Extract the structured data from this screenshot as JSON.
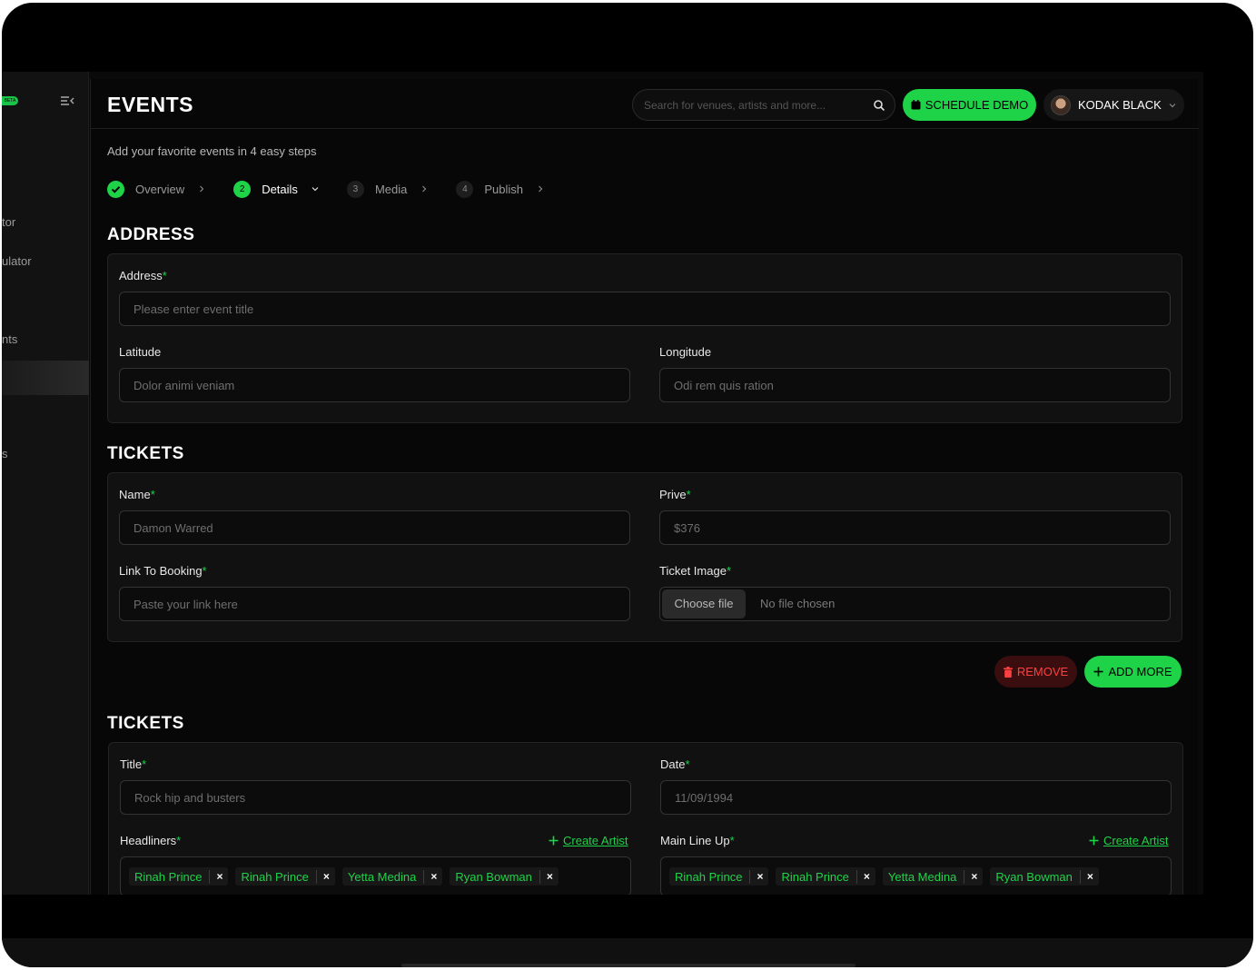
{
  "sidebar": {
    "beta_label": "BETA",
    "items": [
      {
        "label": "tor"
      },
      {
        "label": "ulator"
      },
      {
        "label": "nts"
      },
      {
        "label": ""
      },
      {
        "label": "s"
      }
    ]
  },
  "header": {
    "title": "EVENTS",
    "search_placeholder": "Search for venues, artists and more...",
    "schedule_label": "SCHEDULE DEMO",
    "user_name": "KODAK BLACK"
  },
  "subtitle": "Add your favorite events in 4 easy steps",
  "steps": [
    {
      "num": "",
      "label": "Overview"
    },
    {
      "num": "2",
      "label": "Details"
    },
    {
      "num": "3",
      "label": "Media"
    },
    {
      "num": "4",
      "label": "Publish"
    }
  ],
  "address": {
    "title": "ADDRESS",
    "address_label": "Address",
    "address_placeholder": "Please enter event title",
    "latitude_label": "Latitude",
    "latitude_placeholder": "Dolor animi veniam",
    "longitude_label": "Longitude",
    "longitude_placeholder": "Odi rem quis ration"
  },
  "tickets": {
    "title": "TICKETS",
    "name_label": "Name",
    "name_placeholder": "Damon Warred",
    "price_label": "Prive",
    "price_placeholder": "$376",
    "link_label": "Link To Booking",
    "link_placeholder": "Paste your link here",
    "image_label": "Ticket Image",
    "choose_file": "Choose file",
    "no_file": "No file chosen",
    "remove_label": "REMOVE",
    "add_more_label": "ADD MORE"
  },
  "tickets2": {
    "title": "TICKETS",
    "title_label": "Title",
    "title_placeholder": "Rock hip and busters",
    "date_label": "Date",
    "date_placeholder": "11/09/1994",
    "headliners_label": "Headliners",
    "mainlineup_label": "Main Line Up",
    "create_artist": "Create Artist",
    "headliners": [
      "Rinah Prince",
      "Rinah Prince",
      "Yetta Medina",
      "Ryan Bowman"
    ],
    "mainlineup": [
      "Rinah Prince",
      "Rinah Prince",
      "Yetta Medina",
      "Ryan Bowman"
    ],
    "remove_tag": "×"
  },
  "colors": {
    "accent": "#1ed348",
    "danger": "#ff4040",
    "background": "#070707"
  }
}
